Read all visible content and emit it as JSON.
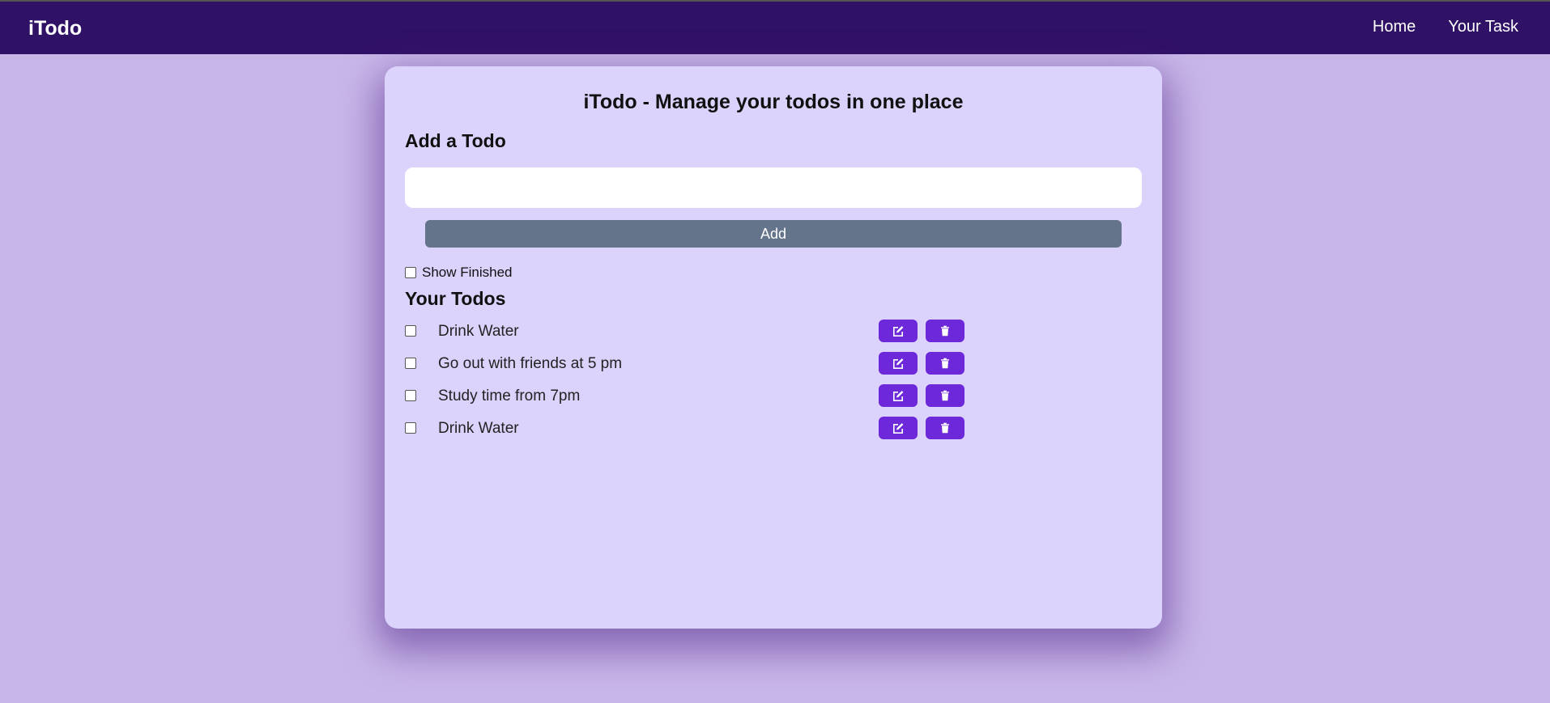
{
  "navbar": {
    "brand": "iTodo",
    "links": [
      {
        "label": "Home"
      },
      {
        "label": "Your Task"
      }
    ]
  },
  "card": {
    "title": "iTodo - Manage your todos in one place",
    "add_heading": "Add a Todo",
    "input": {
      "value": "",
      "placeholder": ""
    },
    "add_button_label": "Add",
    "show_finished_label": "Show Finished",
    "show_finished_checked": false,
    "todos_heading": "Your Todos"
  },
  "todos": [
    {
      "text": "Drink Water",
      "completed": false
    },
    {
      "text": "Go out with friends at 5 pm",
      "completed": false
    },
    {
      "text": "Study time from 7pm",
      "completed": false
    },
    {
      "text": "Drink Water",
      "completed": false
    }
  ],
  "icons": {
    "edit": "edit-icon",
    "delete": "trash-icon"
  },
  "colors": {
    "navbar": "#2f1166",
    "page_background": "#c9b6e8",
    "card_background": "#dcd3fd",
    "add_button": "#64748b",
    "action_button": "#6d28d9"
  }
}
